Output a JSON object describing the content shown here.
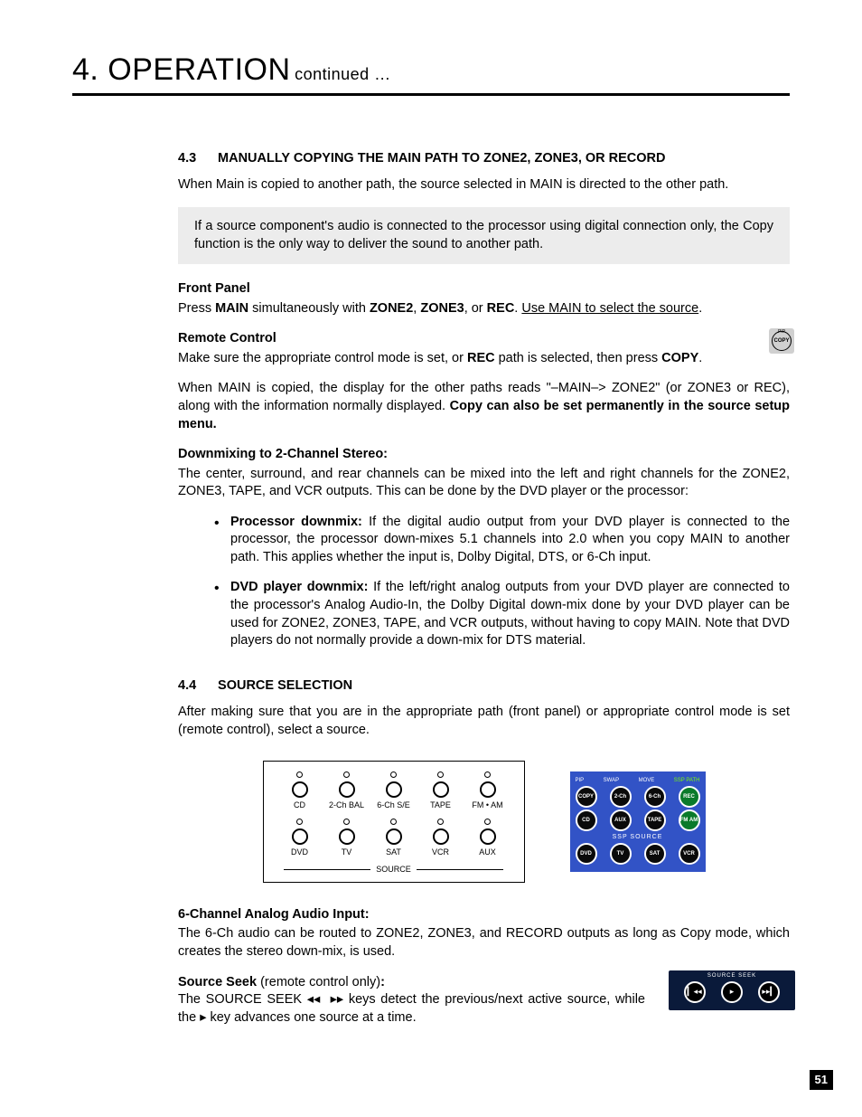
{
  "chapter": {
    "title": "4. OPERATION",
    "continued": "continued …"
  },
  "section43": {
    "num": "4.3",
    "title": "MANUALLY COPYING THE MAIN PATH TO ZONE2, ZONE3, OR RECORD",
    "intro": "When Main is copied to another path, the source selected in MAIN is directed to the other path.",
    "callout": "If a source component's audio is connected to the processor using digital connection only, the Copy function is the only way to deliver the sound to another path.",
    "fp_head": "Front Panel",
    "fp_pre": "Press ",
    "fp_main": "MAIN",
    "fp_mid1": " simultaneously with ",
    "fp_zone2": "ZONE2",
    "fp_comma": ", ",
    "fp_zone3": "ZONE3",
    "fp_or": ", or ",
    "fp_rec": "REC",
    "fp_dot": ". ",
    "fp_under": "Use MAIN to select the source",
    "fp_end": ".",
    "rc_head": "Remote Control",
    "rc_pre": "Make sure the appropriate control mode is set, or ",
    "rc_rec": "REC",
    "rc_mid": " path is selected, then press ",
    "rc_copy": "COPY",
    "rc_end": ".",
    "copied_p1": "When MAIN is copied, the display for the other paths reads \"–MAIN–> ZONE2\" (or ZONE3 or REC), along with the information normally displayed. ",
    "copied_b": "Copy can also be set permanently in the source setup menu.",
    "dm_head": "Downmixing to 2-Channel Stereo:",
    "dm_body": "The center, surround, and rear channels can be mixed into the left and right channels for the ZONE2, ZONE3, TAPE, and VCR outputs. This can be done by the DVD player or the processor:",
    "b1_head": "Processor downmix:",
    "b1_body": "  If the digital audio output from your DVD player is connected to the processor, the processor down-mixes 5.1 channels into 2.0 when you copy MAIN to another path. This applies whether the input is, Dolby Digital, DTS, or 6-Ch input.",
    "b2_head": "DVD player downmix:",
    "b2_body": "  If the left/right analog outputs from your DVD player are connected to the processor's Analog Audio-In, the Dolby Digital down-mix done by your DVD player can be used for ZONE2, ZONE3, TAPE, and VCR outputs, without having to copy MAIN. Note that DVD players do not normally provide a down-mix for DTS material."
  },
  "section44": {
    "num": "4.4",
    "title": "SOURCE SELECTION",
    "intro": "After making sure that you are in the appropriate path (front panel) or appropriate control mode is set (remote control), select a source.",
    "panel": {
      "row1": [
        "CD",
        "2-Ch BAL",
        "6-Ch S/E",
        "TAPE",
        "FM • AM"
      ],
      "row2": [
        "DVD",
        "TV",
        "SAT",
        "VCR",
        "AUX"
      ],
      "source_label": "SOURCE"
    },
    "remote": {
      "top_labels": [
        "PIP",
        "SWAP",
        "MOVE",
        "SSP PATH"
      ],
      "row1": [
        "COPY",
        "2-Ch",
        "6-Ch",
        "REC"
      ],
      "row2": [
        "CD",
        "AUX",
        "TAPE",
        "FM AM"
      ],
      "mid_label": "SSP SOURCE",
      "row3": [
        "DVD",
        "TV",
        "SAT",
        "VCR"
      ]
    },
    "six_head": "6-Channel Analog Audio Input:",
    "six_body": "The 6-Ch audio can be routed to ZONE2, ZONE3, and RECORD outputs as long as Copy mode, which creates the stereo down-mix, is used.",
    "seek_head": "Source Seek",
    "seek_suffix": " (remote control only)",
    "seek_colon": ":",
    "seek_body1": "The SOURCE SEEK ",
    "seek_body2": " keys detect the previous/next active source, while the ",
    "seek_body3": " key advances one source at a time.",
    "seek_label": "SOURCE SEEK"
  },
  "icons": {
    "copy_pip": "PIP",
    "copy_txt": "COPY",
    "rew": "◂◂",
    "fwd": "▸▸",
    "play": "▸",
    "skipback": "▎◂◂",
    "skipfwd": "▸▸▎"
  },
  "page": "51"
}
